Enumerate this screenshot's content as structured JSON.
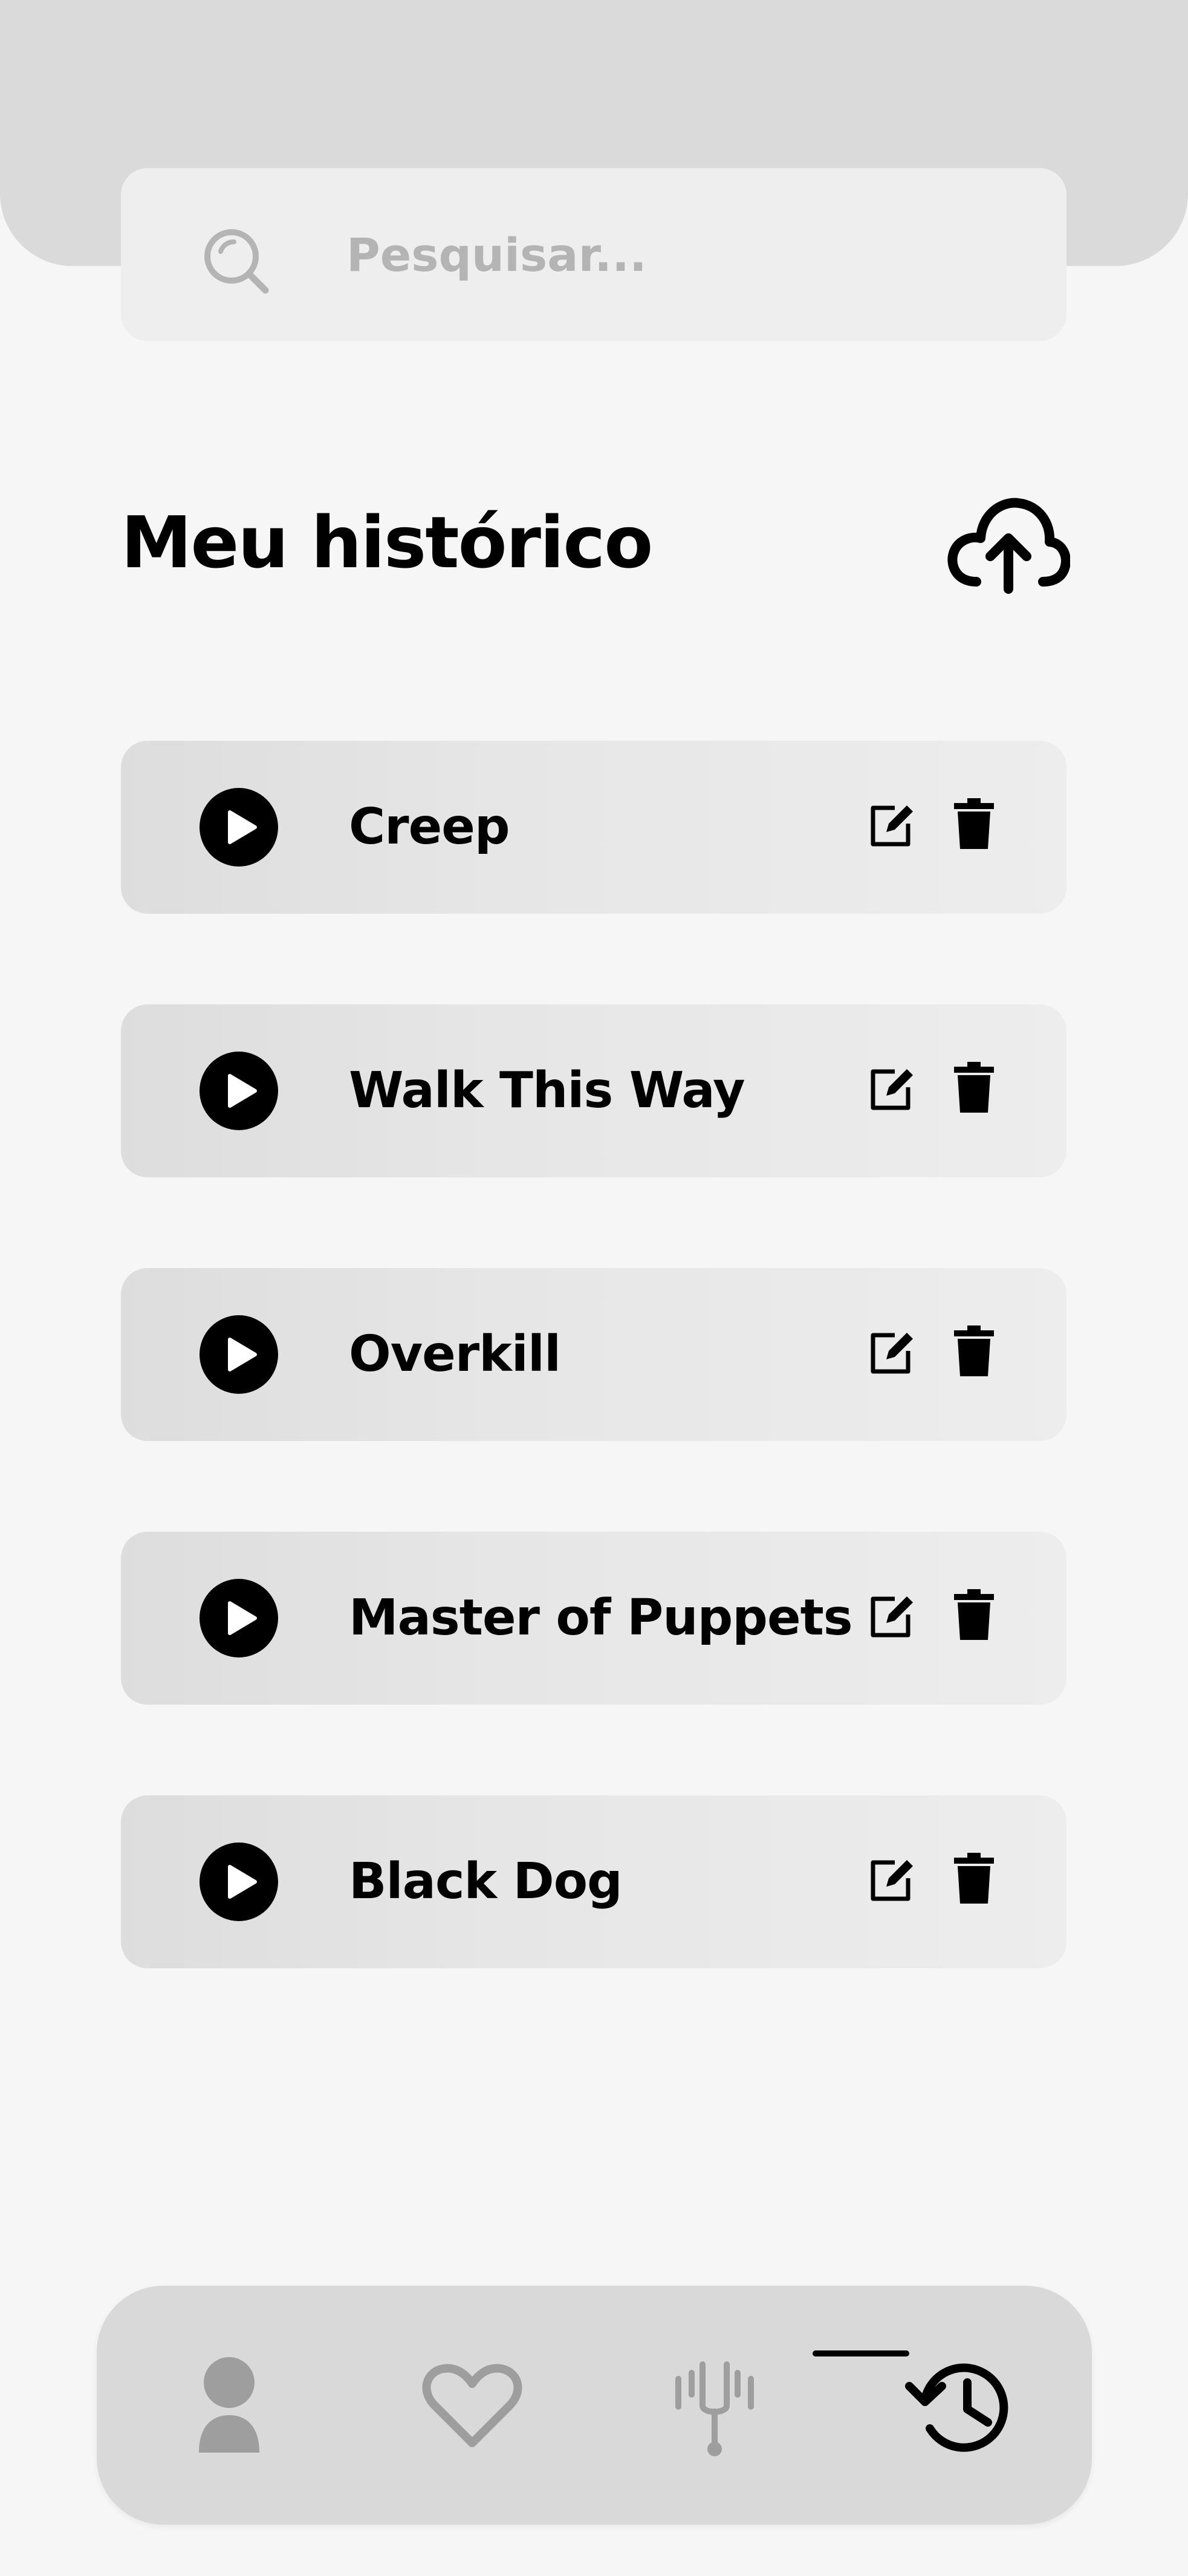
{
  "search": {
    "placeholder": "Pesquisar..."
  },
  "header": {
    "title": "Meu histórico",
    "upload_icon": "cloud-upload-icon"
  },
  "history": [
    {
      "title": "Creep"
    },
    {
      "title": "Walk This Way"
    },
    {
      "title": "Overkill"
    },
    {
      "title": "Master of Puppets"
    },
    {
      "title": "Black Dog"
    }
  ],
  "item_actions": {
    "play_icon": "play-icon",
    "edit_icon": "edit-icon",
    "delete_icon": "trash-icon"
  },
  "nav": {
    "items": [
      {
        "icon": "user-icon",
        "active": false
      },
      {
        "icon": "heart-icon",
        "active": false
      },
      {
        "icon": "tuning-fork-icon",
        "active": false
      },
      {
        "icon": "history-icon",
        "active": true
      }
    ]
  },
  "colors": {
    "background": "#f6f6f6",
    "header": "#dadada",
    "card": "#e6e6e6",
    "inactive_icon": "#9e9e9e",
    "active_icon": "#000000"
  }
}
